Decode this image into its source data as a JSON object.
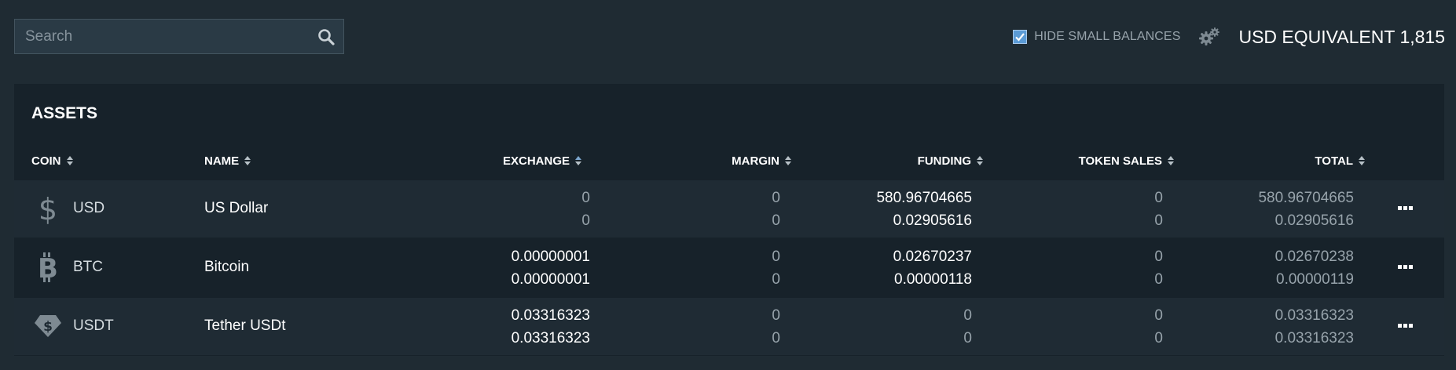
{
  "search": {
    "placeholder": "Search"
  },
  "top_bar": {
    "hide_small_balances": {
      "label": "HIDE SMALL BALANCES",
      "checked": true
    },
    "usd_equivalent_label": "USD EQUIVALENT",
    "usd_equivalent_value": "1,815"
  },
  "assets": {
    "title": "ASSETS",
    "columns": [
      "COIN",
      "NAME",
      "EXCHANGE",
      "MARGIN",
      "FUNDING",
      "TOKEN SALES",
      "TOTAL"
    ],
    "rows": [
      {
        "icon": "dollar-icon",
        "coin": "USD",
        "name": "US Dollar",
        "exchange": [
          "0",
          "0"
        ],
        "margin": [
          "0",
          "0"
        ],
        "funding": [
          "580.96704665",
          "0.02905616"
        ],
        "token_sales": [
          "0",
          "0"
        ],
        "total": [
          "580.96704665",
          "0.02905616"
        ]
      },
      {
        "icon": "bitcoin-icon",
        "coin": "BTC",
        "name": "Bitcoin",
        "exchange": [
          "0.00000001",
          "0.00000001"
        ],
        "margin": [
          "0",
          "0"
        ],
        "funding": [
          "0.02670237",
          "0.00000118"
        ],
        "token_sales": [
          "0",
          "0"
        ],
        "total": [
          "0.02670238",
          "0.00000119"
        ]
      },
      {
        "icon": "tether-icon",
        "coin": "USDT",
        "name": "Tether USDt",
        "exchange": [
          "0.03316323",
          "0.03316323"
        ],
        "margin": [
          "0",
          "0"
        ],
        "funding": [
          "0",
          "0"
        ],
        "token_sales": [
          "0",
          "0"
        ],
        "total": [
          "0.03316323",
          "0.03316323"
        ]
      }
    ]
  },
  "colors": {
    "background": "#1f2b33",
    "panel": "#17222a",
    "row_alt": "#1f2b34",
    "accent_checkbox": "#5b9bd6"
  }
}
